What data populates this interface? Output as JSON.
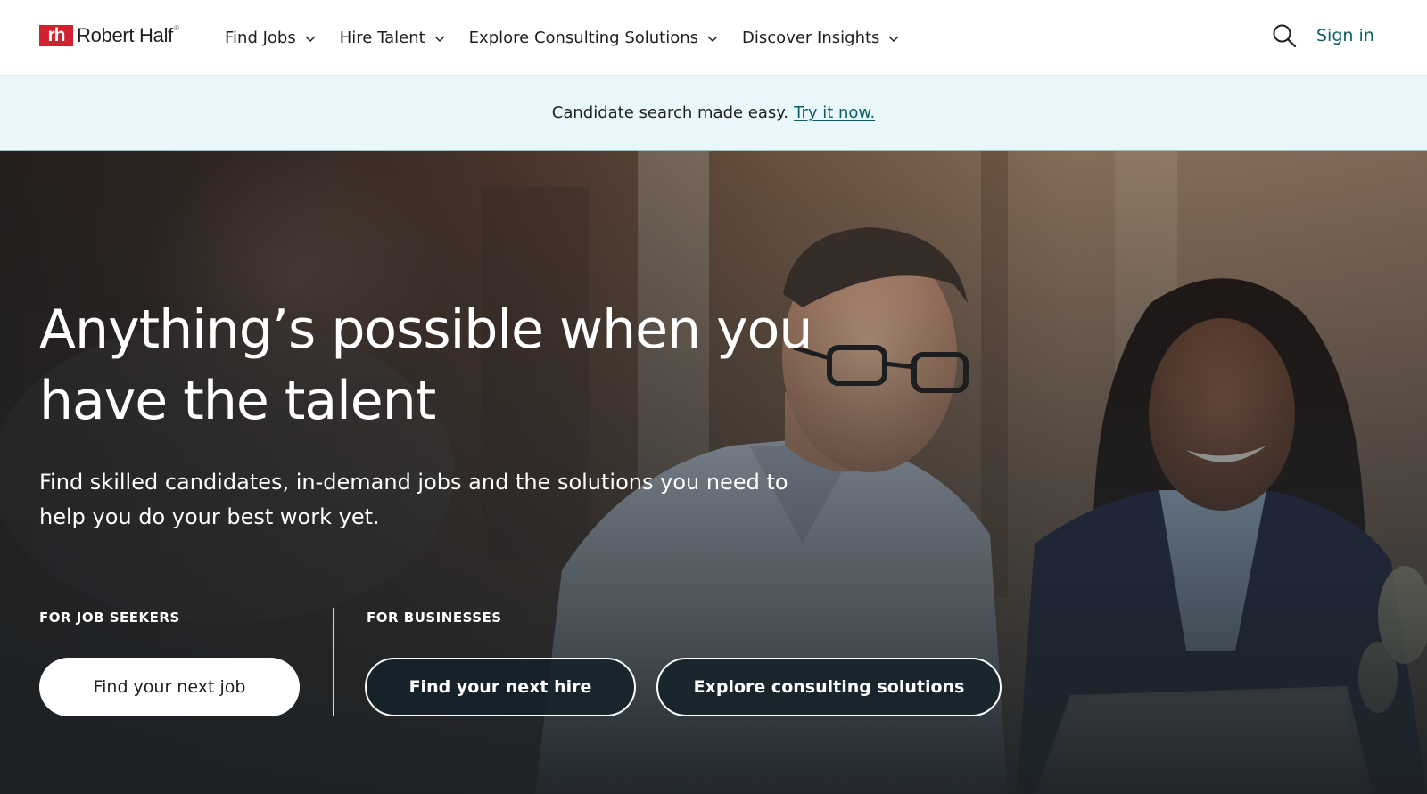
{
  "brand": {
    "mark": "rh",
    "name": "Robert Half",
    "trademark": "®",
    "color": "#d1202f"
  },
  "nav": {
    "items": [
      {
        "label": "Find Jobs",
        "icon": "chevron-down-icon"
      },
      {
        "label": "Hire Talent",
        "icon": "chevron-down-icon"
      },
      {
        "label": "Explore Consulting Solutions",
        "icon": "chevron-down-icon"
      },
      {
        "label": "Discover Insights",
        "icon": "chevron-down-icon"
      }
    ],
    "search_icon": "search-icon",
    "sign_in": "Sign in"
  },
  "announcement": {
    "text": "Candidate search made easy.",
    "link": "Try it now."
  },
  "hero": {
    "headline_line1": "Anything’s possible when you",
    "headline_line2": "have the talent",
    "subhead_line1": "Find skilled candidates, in-demand jobs and the solutions you need to",
    "subhead_line2": "help you do your best work yet.",
    "job_seekers_label": "FOR JOB SEEKERS",
    "businesses_label": "FOR BUSINESSES",
    "buttons": {
      "find_job": "Find your next job",
      "find_hire": "Find your next hire",
      "explore_consulting": "Explore consulting solutions"
    }
  },
  "colors": {
    "accent": "#0b5e67",
    "announce_bg": "#e9f7fb",
    "button_dark": "#14222a"
  }
}
